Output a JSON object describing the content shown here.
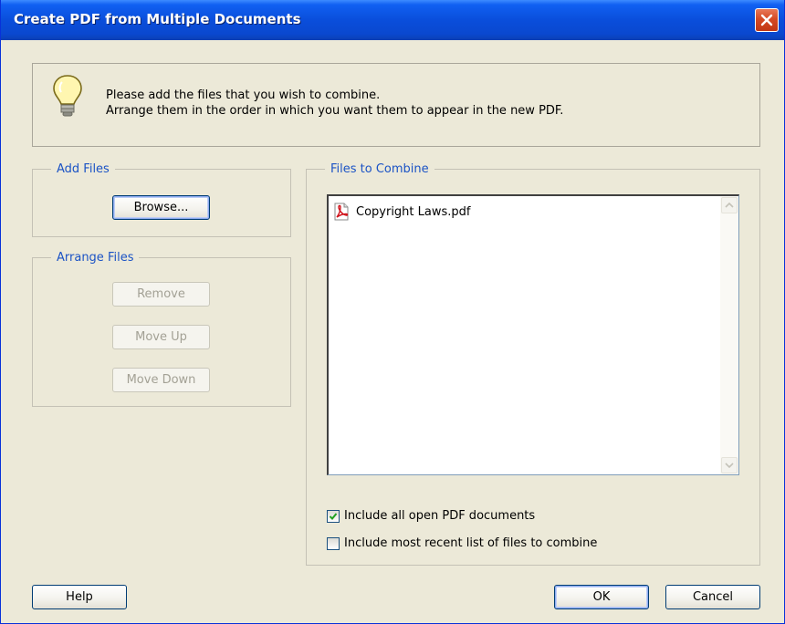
{
  "window": {
    "title": "Create PDF from Multiple Documents"
  },
  "info": {
    "line1": "Please add the files that you wish to combine.",
    "line2": "Arrange them in the order in which you want them to appear in the new PDF."
  },
  "add_files": {
    "legend": "Add Files",
    "browse_label": "Browse..."
  },
  "arrange_files": {
    "legend": "Arrange Files",
    "remove_label": "Remove",
    "move_up_label": "Move Up",
    "move_down_label": "Move Down"
  },
  "files_to_combine": {
    "legend": "Files to Combine",
    "files": [
      {
        "name": "Copyright Laws.pdf",
        "icon": "pdf-file-icon"
      }
    ]
  },
  "options": {
    "include_open": {
      "label": "Include all open PDF documents",
      "checked": true
    },
    "include_recent": {
      "label": "Include most recent list of files to combine",
      "checked": false
    }
  },
  "footer": {
    "help_label": "Help",
    "ok_label": "OK",
    "cancel_label": "Cancel"
  },
  "colors": {
    "titlebar": "#0A4EDB",
    "group_label": "#1B53C5",
    "dialog_bg": "#ECE9D8",
    "close_button": "#D54A24"
  }
}
